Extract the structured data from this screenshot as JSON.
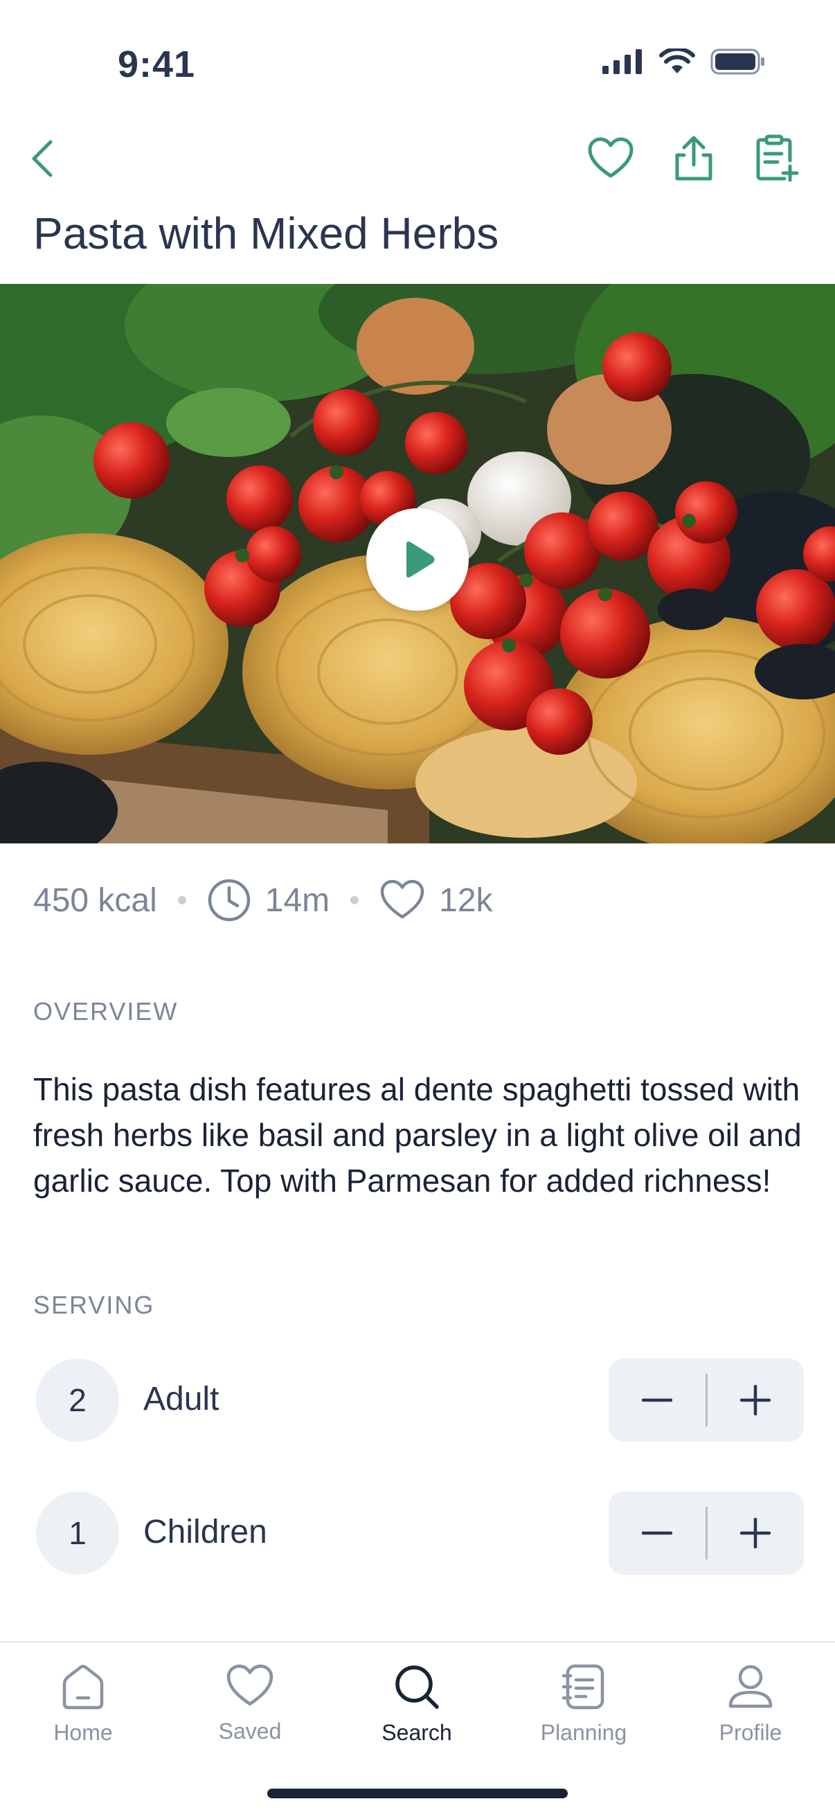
{
  "status": {
    "time": "9:41"
  },
  "recipe": {
    "title": "Pasta with Mixed Herbs",
    "kcal": "450 kcal",
    "time": "14m",
    "likes": "12k"
  },
  "overview": {
    "label": "OVERVIEW",
    "text": "This pasta dish features al dente spaghetti tossed with fresh herbs like basil and parsley in a light olive oil and garlic sauce. Top with Parmesan for added richness!"
  },
  "serving": {
    "label": "SERVING",
    "rows": [
      {
        "count": "2",
        "label": "Adult"
      },
      {
        "count": "1",
        "label": "Children"
      }
    ]
  },
  "tabs": [
    {
      "label": "Home",
      "icon": "home-icon"
    },
    {
      "label": "Saved",
      "icon": "heart-icon"
    },
    {
      "label": "Search",
      "icon": "search-icon",
      "active": true
    },
    {
      "label": "Planning",
      "icon": "planning-icon"
    },
    {
      "label": "Profile",
      "icon": "profile-icon"
    }
  ],
  "colors": {
    "accent": "#3a9a78",
    "text": "#2a3550",
    "muted": "#7a8597"
  }
}
